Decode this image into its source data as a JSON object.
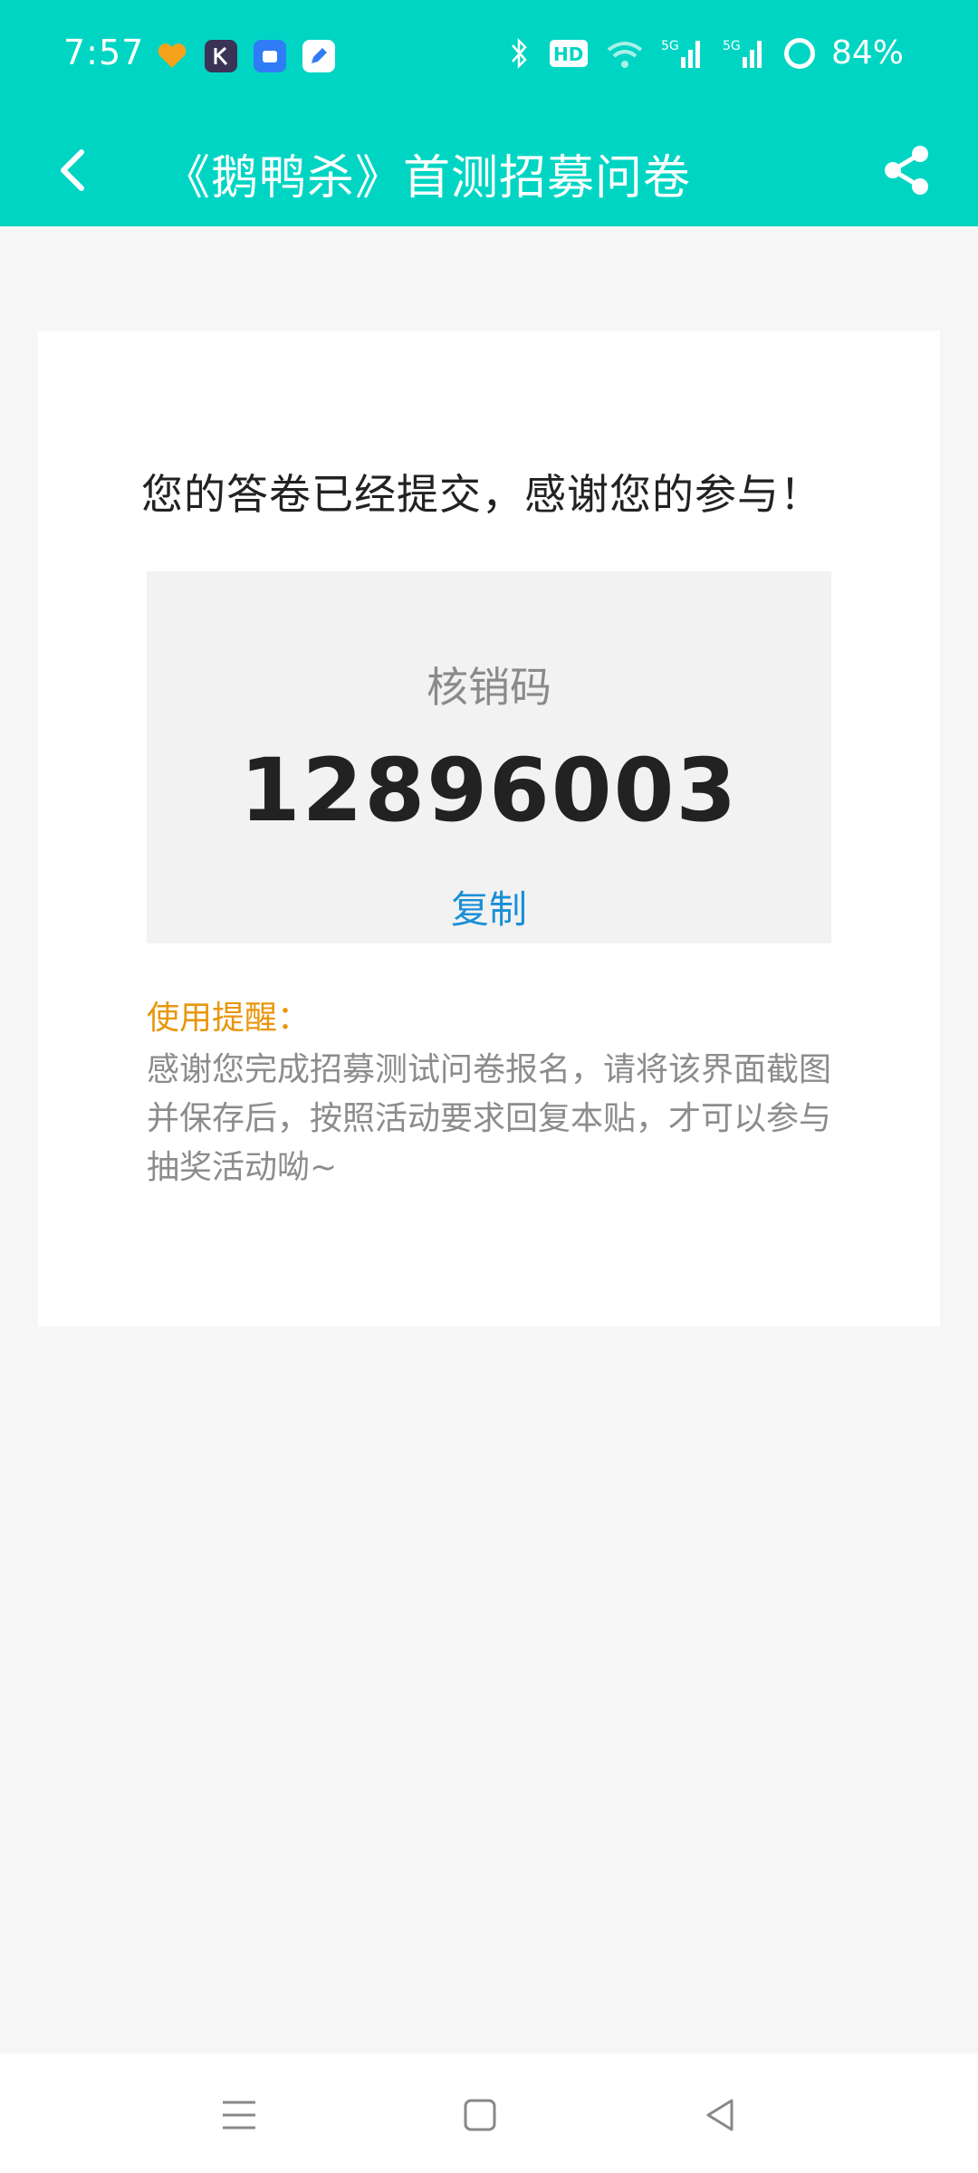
{
  "status_bar": {
    "time": "7:57",
    "battery": "84%",
    "icons": [
      "heart-app-icon",
      "k-app-icon",
      "blue-app-icon",
      "pen-app-icon",
      "bluetooth-icon",
      "hd-icon",
      "wifi-icon",
      "signal-5g-icon",
      "signal-5g-icon",
      "battery-ring-icon"
    ]
  },
  "app_bar": {
    "title": "《鹅鸭杀》首测招募问卷"
  },
  "card": {
    "headline": "您的答卷已经提交，感谢您的参与！",
    "code_label": "核销码",
    "code_value": "12896003",
    "copy_label": "复制",
    "reminder_title": "使用提醒：",
    "reminder_body": "感谢您完成招募测试问卷报名，请将该界面截图并保存后，按照活动要求回复本贴，才可以参与抽奖活动呦~"
  },
  "colors": {
    "accent": "#00d5c3",
    "link": "#1a8fd6",
    "reminder": "#e8960d"
  }
}
